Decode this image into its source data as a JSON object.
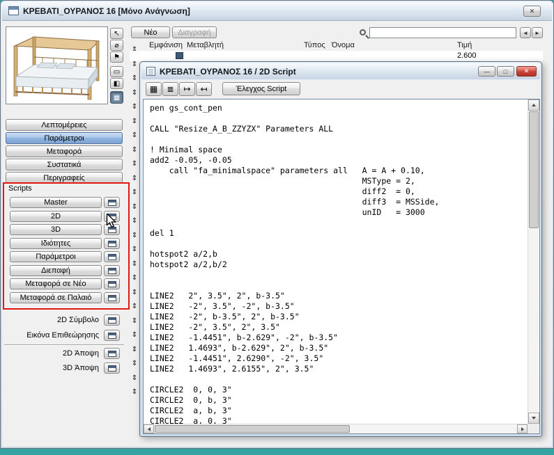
{
  "colors": {
    "desktop-teal": "#36a3a3",
    "accent-blue": "#7ca5d4",
    "annotation-red": "#e3170b",
    "close-red": "#c94436"
  },
  "main_window": {
    "title": "ΚΡΕΒΑΤΙ_ΟΥΡΑΝΟΣ 16 [Μόνο Ανάγνωση]",
    "close_glyph": "✕"
  },
  "top_toolbar": {
    "new_label": "Νέο",
    "delete_label": "Διαγραφή",
    "search_value": "",
    "prev_glyph": "◄",
    "next_glyph": "►"
  },
  "parameter_table": {
    "headers": [
      "Εμφάνιση",
      "Μεταβλητή",
      "Τύπος",
      "Όνομα",
      "Τιμή"
    ],
    "row_handle_glyph": "⇕",
    "row_handle_count": 25,
    "visible_row_value": "2.600"
  },
  "left_panel": {
    "nav_buttons": [
      {
        "label": "Λεπτομέρειες"
      },
      {
        "label": "Παράμετροι"
      },
      {
        "label": "Μεταφορά"
      },
      {
        "label": "Συστατικά"
      },
      {
        "label": "Περιγραφείς"
      }
    ],
    "preview_tools": [
      {
        "name": "pointer",
        "glyph": "↖"
      },
      {
        "name": "ellipse",
        "glyph": "⌀"
      },
      {
        "name": "flag",
        "glyph": "⚑"
      },
      {
        "name": "box",
        "glyph": "▭"
      },
      {
        "name": "box-shaded",
        "glyph": "◧"
      },
      {
        "name": "grid",
        "glyph": "▦"
      }
    ],
    "scripts_label": "Scripts",
    "script_items": [
      {
        "label": "Master"
      },
      {
        "label": "2D"
      },
      {
        "label": "3D"
      },
      {
        "label": "Ιδιότητες"
      },
      {
        "label": "Παράμετροι"
      },
      {
        "label": "Διεπαφή"
      },
      {
        "label": "Μεταφορά σε Νέο"
      },
      {
        "label": "Μεταφορά σε Παλαιό"
      }
    ],
    "symbol_items": [
      {
        "label": "2D Σύμβολο"
      },
      {
        "label": "Εικόνα Επιθεώρησης"
      }
    ],
    "view_items": [
      {
        "label": "2D Άποψη"
      },
      {
        "label": "3D Άποψη"
      }
    ]
  },
  "script_window": {
    "title": "ΚΡΕΒΑΤΙ_ΟΥΡΑΝΟΣ 16 / 2D Script",
    "minimize_glyph": "—",
    "maximize_glyph": "□",
    "close_glyph": "✕",
    "toolbar_icons": [
      {
        "name": "dot-grid",
        "glyph": "▦"
      },
      {
        "name": "list",
        "glyph": "≣"
      },
      {
        "name": "indent",
        "glyph": "↦"
      },
      {
        "name": "outdent",
        "glyph": "↤"
      }
    ],
    "check_button_label": "Έλεγχος Script",
    "code": "pen gs_cont_pen\n\nCALL \"Resize_A_B_ZZYZX\" Parameters ALL\n\n! Minimal space\nadd2 -0.05, -0.05\n    call \"fa_minimalspace\" parameters all   A = A + 0.10,\n                                            MSType = 2,\n                                            diff2  = 0,\n                                            diff3  = MSSide,\n                                            unID   = 3000\n\ndel 1\n\nhotspot2 a/2,b\nhotspot2 a/2,b/2\n\n\nLINE2   2\", 3.5\", 2\", b-3.5\"\nLINE2   -2\", 3.5\", -2\", b-3.5\"\nLINE2   -2\", b-3.5\", 2\", b-3.5\"\nLINE2   -2\", 3.5\", 2\", 3.5\"\nLINE2   -1.4451\", b-2.629\", -2\", b-3.5\"\nLINE2   1.4693\", b-2.629\", 2\", b-3.5\"\nLINE2   -1.4451\", 2.6290\", -2\", 3.5\"\nLINE2   1.4693\", 2.6155\", 2\", 3.5\"\n\nCIRCLE2  0, 0, 3\"\nCIRCLE2  0, b, 3\"\nCIRCLE2  a, b, 3\"\nCIRCLE2  a, 0, 3\""
  }
}
